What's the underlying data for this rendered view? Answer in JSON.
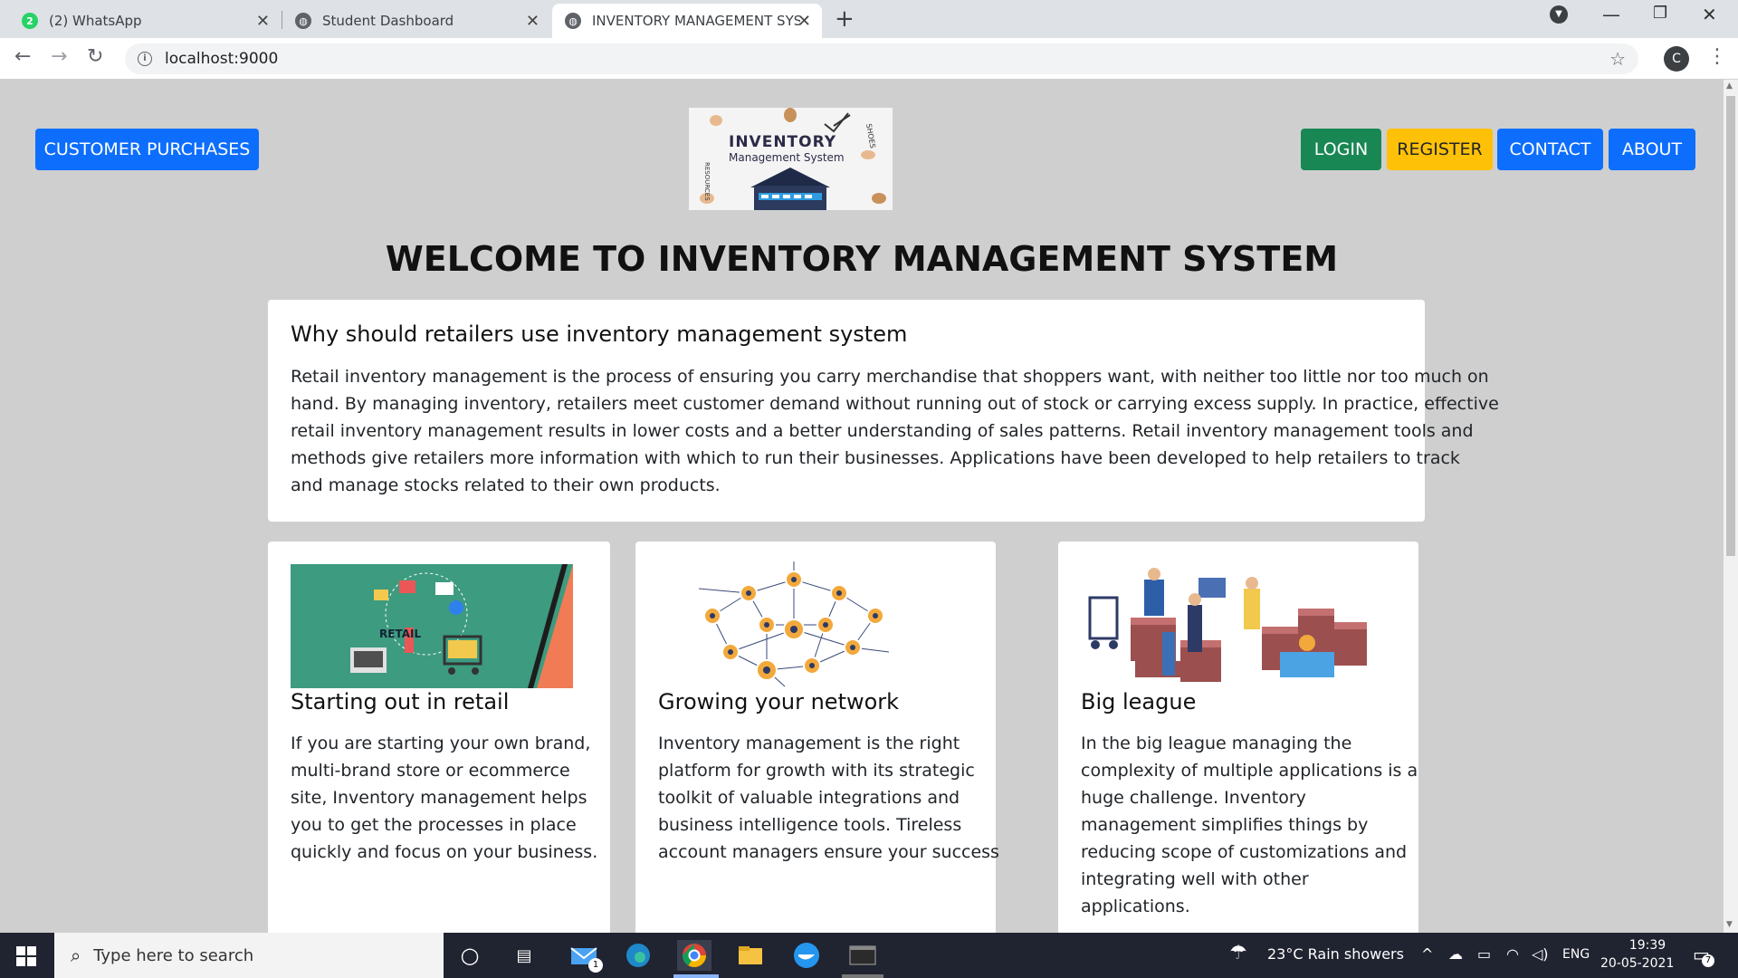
{
  "browser": {
    "tabs": [
      {
        "title": "(2) WhatsApp",
        "badge": "2"
      },
      {
        "title": "Student Dashboard"
      },
      {
        "title": "INVENTORY MANAGEMENT SYST"
      }
    ],
    "url": "localhost:9000",
    "profile_initial": "C"
  },
  "nav": {
    "left_button": "CUSTOMER PURCHASES",
    "login": "LOGIN",
    "register": "REGISTER",
    "contact": "CONTACT",
    "about": "ABOUT"
  },
  "logo": {
    "title": "INVENTORY",
    "subtitle": "Management System",
    "side_text_1": "SHOES",
    "side_text_2": "RESOURCES"
  },
  "page_heading": "WELCOME TO INVENTORY MANAGEMENT SYSTEM",
  "intro": {
    "title": "Why should retailers use inventory management system",
    "lines": [
      "Retail inventory management is the process of ensuring you carry merchandise that shoppers want, with neither too little nor too much on",
      "hand. By managing inventory, retailers meet customer demand without running out of stock or carrying excess supply. In practice, effective",
      "retail inventory management results in lower costs and a better understanding of sales patterns. Retail inventory management tools and",
      "methods give retailers more information with which to run their businesses. Applications have been developed to help retailers to track",
      "and manage stocks related to their own products."
    ]
  },
  "cards": [
    {
      "title": "Starting out in retail",
      "image_label": "RETAIL",
      "lines": [
        "If you are starting your own brand,",
        "multi-brand store or ecommerce",
        "site, Inventory management helps",
        "you to get the processes in place",
        "quickly and focus on your business."
      ]
    },
    {
      "title": "Growing your network",
      "lines": [
        "Inventory management is the right",
        "platform for growth with its strategic",
        "toolkit of valuable integrations and",
        "business intelligence tools. Tireless",
        "account managers ensure your success"
      ]
    },
    {
      "title": "Big league",
      "lines": [
        "In the big league managing the",
        "complexity of multiple applications is a",
        "huge challenge. Inventory",
        "management simplifies things by",
        "reducing scope of customizations and",
        "integrating well with other",
        "applications."
      ]
    }
  ],
  "taskbar": {
    "search_placeholder": "Type here to search",
    "mail_badge": "1",
    "weather": "23°C  Rain showers",
    "lang": "ENG",
    "time": "19:39",
    "date": "20-05-2021",
    "notif_count": "7"
  },
  "colors": {
    "primary": "#0d6efd",
    "success": "#198754",
    "warning": "#ffc107",
    "page_bg": "#cfcfcf"
  }
}
